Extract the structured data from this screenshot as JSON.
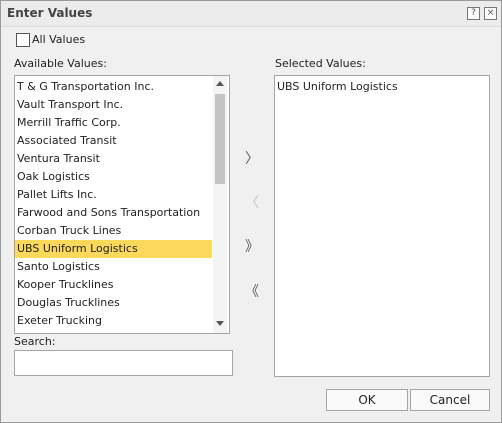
{
  "dialog": {
    "title": "Enter Values",
    "help_glyph": "?",
    "close_glyph": "×"
  },
  "all_values": {
    "label": "All Values",
    "checked": false
  },
  "available": {
    "label": "Available Values:",
    "items": [
      "T & G Transportation Inc.",
      "Vault Transport Inc.",
      "Merrill Traffic Corp.",
      "Associated Transit",
      "Ventura Transit",
      "Oak Logistics",
      "Pallet Lifts Inc.",
      "Farwood and Sons Transportation",
      "Corban Truck Lines",
      "UBS Uniform Logistics",
      "Santo Logistics",
      "Kooper Trucklines",
      "Douglas Trucklines",
      "Exeter Trucking"
    ],
    "selected_item": "UBS Uniform Logistics"
  },
  "selected": {
    "label": "Selected Values:",
    "items": [
      "UBS Uniform Logistics"
    ]
  },
  "move_buttons": {
    "add": "〉",
    "remove": "〈",
    "add_all": "》",
    "remove_all": "《"
  },
  "search": {
    "label": "Search:",
    "value": ""
  },
  "buttons": {
    "ok": "OK",
    "cancel": "Cancel"
  },
  "colors": {
    "selection": "#fcd95a"
  }
}
